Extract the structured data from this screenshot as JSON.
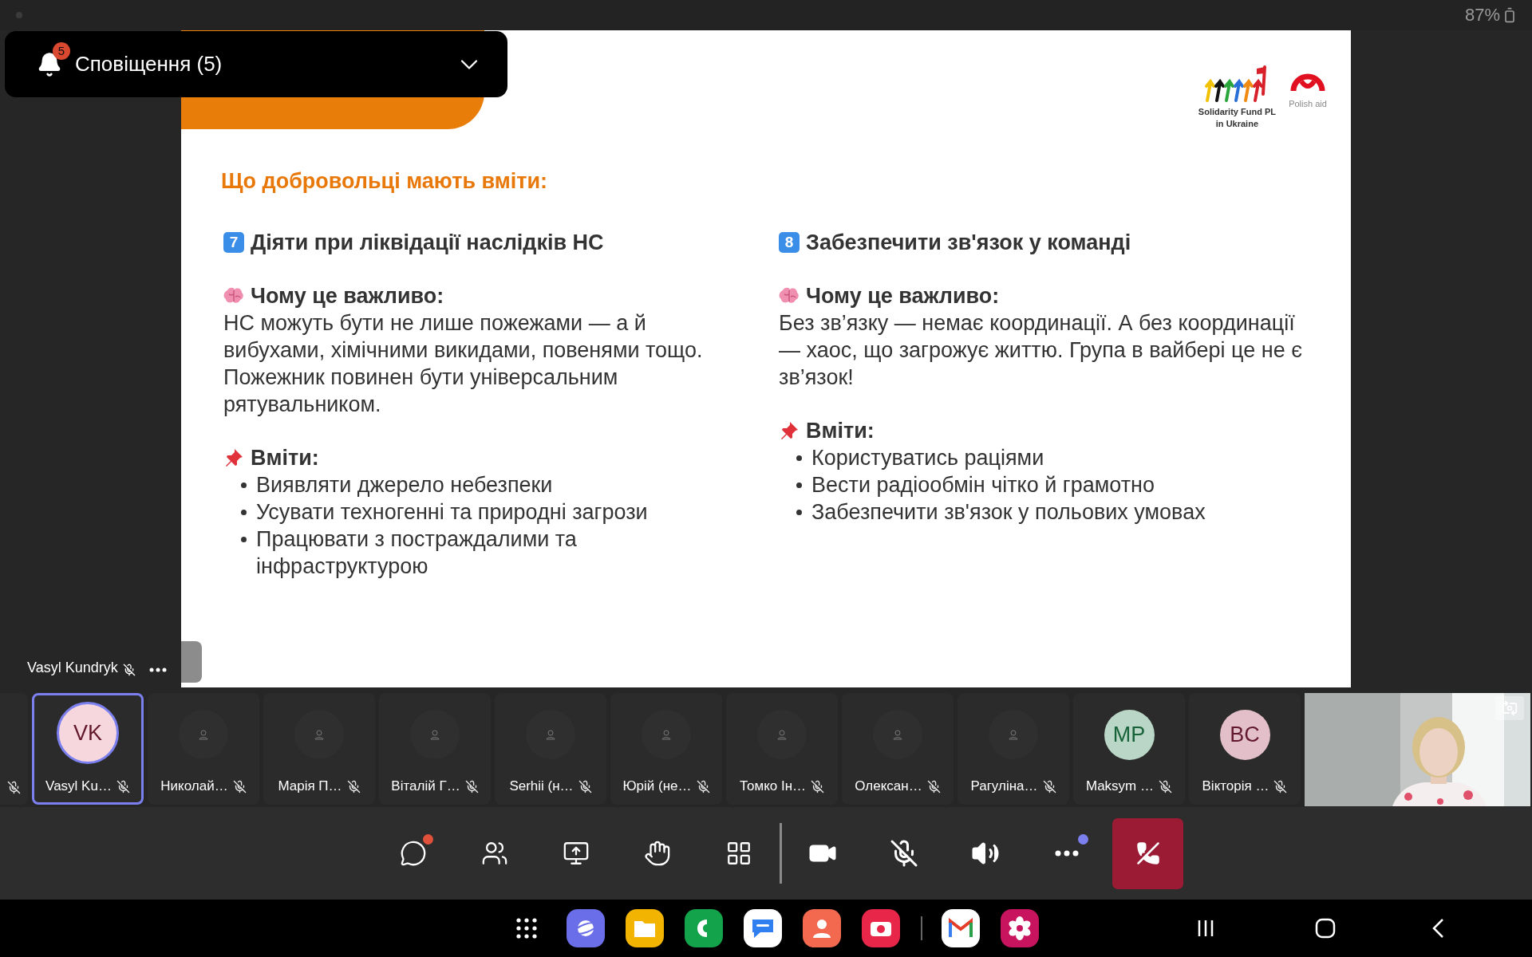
{
  "status_bar": {
    "battery": "87%"
  },
  "notification": {
    "label": "Сповіщення (5)",
    "badge": "5",
    "expanded": false
  },
  "slide": {
    "logos": [
      {
        "kind": "fund",
        "caption_lines": [
          "Solidarity Fund PL",
          "in Ukraine"
        ]
      },
      {
        "kind": "aid",
        "caption_lines": [
          "Polish aid"
        ]
      }
    ],
    "heading": "Що добровольці мають вміти:",
    "columns": [
      {
        "number": "7",
        "title": "Діяти при ліквідації наслідків НС",
        "why_label": "Чому це важливо:",
        "why_text": "НС можуть бути не лише пожежами — а й вибухами, хімічними викидами, повенями тощо. Пожежник повинен бути універсальним рятувальником.",
        "skills_label": "Вміти:",
        "skills": [
          "Виявляти джерело небезпеки",
          "Усувати техногенні та природні загрози",
          "Працювати з постраждалими та інфраструктурою"
        ]
      },
      {
        "number": "8",
        "title": "Забезпечити зв'язок у команді",
        "why_label": "Чому це важливо:",
        "why_text": "Без зв’язку — немає координації. А без координації — хаос, що загрожує життю. Група в вайбері це не є зв’язок!",
        "skills_label": "Вміти:",
        "skills": [
          "Користуватись раціями",
          "Вести радіообмін чітко й грамотно",
          "Забезпечити зв'язок у польових умовах"
        ]
      }
    ]
  },
  "speaker": {
    "name": "Vasyl Kundryk",
    "muted": true
  },
  "participants": [
    {
      "kind": "partial",
      "muted": true,
      "selected": false
    },
    {
      "kind": "initials",
      "initials": "VK",
      "color": "#f6d7de",
      "name": "Vasyl Ku…",
      "muted": true,
      "selected": true
    },
    {
      "kind": "placeholder",
      "name": "Николай…",
      "muted": true,
      "selected": false
    },
    {
      "kind": "placeholder",
      "name": "Марія П…",
      "muted": true,
      "selected": false
    },
    {
      "kind": "placeholder",
      "name": "Віталій Г…",
      "muted": true,
      "selected": false
    },
    {
      "kind": "placeholder",
      "name": "Serhii (н…",
      "muted": true,
      "selected": false
    },
    {
      "kind": "placeholder",
      "name": "Юрій (не…",
      "muted": true,
      "selected": false
    },
    {
      "kind": "placeholder",
      "name": "Томко Ін…",
      "muted": true,
      "selected": false
    },
    {
      "kind": "placeholder",
      "name": "Олексан…",
      "muted": true,
      "selected": false
    },
    {
      "kind": "placeholder",
      "name": "Рагуліна…",
      "muted": true,
      "selected": false
    },
    {
      "kind": "initials",
      "initials": "MP",
      "color": "#b9d6c6",
      "name": "Maksym …",
      "muted": true,
      "selected": false
    },
    {
      "kind": "initials",
      "initials": "BC",
      "color": "#e3bfca",
      "name": "Вікторія …",
      "muted": true,
      "selected": false
    },
    {
      "kind": "video"
    }
  ],
  "toolbar": {
    "actions": [
      {
        "kind": "chat",
        "notify": true,
        "color": "#e0503a"
      },
      {
        "kind": "people",
        "notify": false
      },
      {
        "kind": "share",
        "notify": false
      },
      {
        "kind": "react",
        "notify": false
      },
      {
        "kind": "apps",
        "notify": false
      }
    ],
    "devices": [
      {
        "kind": "camera",
        "on": true
      },
      {
        "kind": "mic",
        "on": false
      },
      {
        "kind": "speaker",
        "on": true
      }
    ],
    "more": {
      "notify": true,
      "color": "#7b80ee"
    }
  }
}
